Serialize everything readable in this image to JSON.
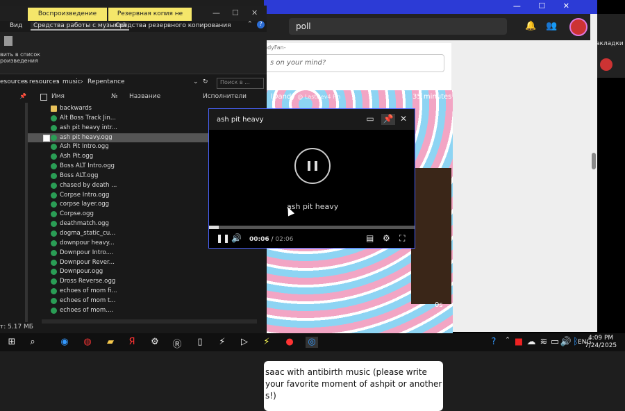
{
  "browser": {
    "search_value": "poll",
    "right_panel_text": "акладки",
    "post_author": "lDandy",
    "post_author_handle": "@ LastDev4 Fin",
    "post_time": "35 minutes",
    "post_media_length": "0s",
    "post_prompt_user": "ndyFan-",
    "post_placeholder": "s on your mind?",
    "post_text": "saac with antibirth music (please write your favorite moment of ashpit or another s!)"
  },
  "explorer": {
    "context_tabs": [
      "Воспроизведение",
      "Резервная копия не создана"
    ],
    "ribbon_tabs": [
      "Вид",
      "Средства работы с музыкой",
      "Средства резервного копирования"
    ],
    "ribbon_button": "вить в список\nроизведения",
    "breadcrumb": [
      "esources",
      "resources",
      "music",
      "Repentance"
    ],
    "search_placeholder": "Поиск в ...",
    "columns": [
      "Имя",
      "№",
      "Название",
      "Исполнители"
    ],
    "files": [
      {
        "name": "backwards",
        "type": "folder"
      },
      {
        "name": "Alt Boss Track Jin...",
        "type": "audio"
      },
      {
        "name": "ash pit heavy intr...",
        "type": "audio"
      },
      {
        "name": "ash pit heavy.ogg",
        "type": "audio",
        "selected": true
      },
      {
        "name": "Ash Pit Intro.ogg",
        "type": "audio"
      },
      {
        "name": "Ash Pit.ogg",
        "type": "audio"
      },
      {
        "name": "Boss ALT Intro.ogg",
        "type": "audio"
      },
      {
        "name": "Boss ALT.ogg",
        "type": "audio"
      },
      {
        "name": "chased by death ...",
        "type": "audio"
      },
      {
        "name": "Corpse Intro.ogg",
        "type": "audio"
      },
      {
        "name": "corpse layer.ogg",
        "type": "audio"
      },
      {
        "name": "Corpse.ogg",
        "type": "audio"
      },
      {
        "name": "deathmatch.ogg",
        "type": "audio"
      },
      {
        "name": "dogma_static_cu...",
        "type": "audio"
      },
      {
        "name": "downpour heavy...",
        "type": "audio"
      },
      {
        "name": "Downpour Intro....",
        "type": "audio"
      },
      {
        "name": "Downpour Rever...",
        "type": "audio"
      },
      {
        "name": "Downpour.ogg",
        "type": "audio"
      },
      {
        "name": "Dross Reverse.ogg",
        "type": "audio"
      },
      {
        "name": "echoes of mom fi...",
        "type": "audio"
      },
      {
        "name": "echoes of mom t...",
        "type": "audio"
      },
      {
        "name": "echoes of mom....",
        "type": "audio"
      }
    ],
    "status": "т: 5.17 МБ"
  },
  "pip": {
    "title": "ash pit heavy",
    "track": "ash pit heavy",
    "time_current": "00:06",
    "time_separator": "/",
    "time_total": "02:06",
    "progress_fraction": 0.048
  },
  "taskbar": {
    "time": "4:09 PM",
    "date": "7/24/2025",
    "lang": "ENG"
  },
  "icons": {
    "search": "search-icon",
    "pause": "pause-icon",
    "volume": "volume-icon",
    "settings": "gear-icon"
  }
}
